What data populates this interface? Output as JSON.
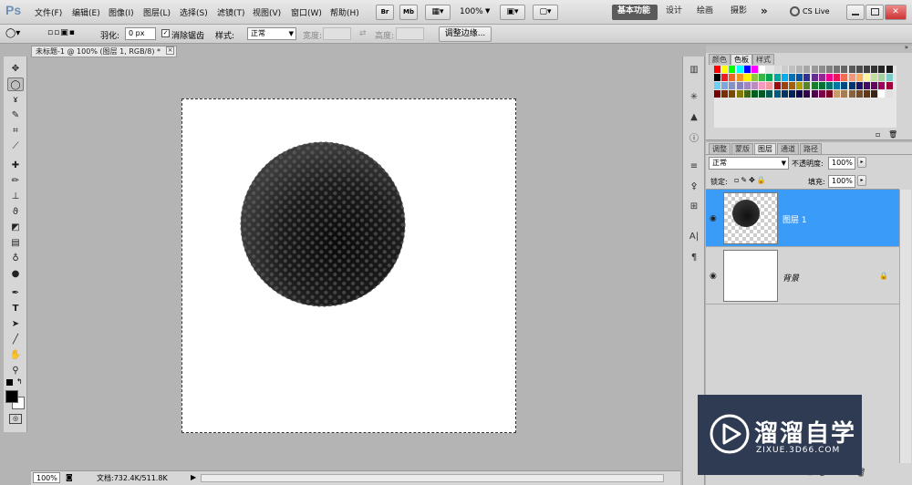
{
  "app": {
    "logo": "Ps",
    "menus": [
      "文件(F)",
      "编辑(E)",
      "图像(I)",
      "图层(L)",
      "选择(S)",
      "滤镜(T)",
      "视图(V)",
      "窗口(W)",
      "帮助(H)"
    ],
    "quick_buttons": [
      "Br",
      "Mb"
    ],
    "zoom_value": "100%",
    "workspaces": [
      "基本功能",
      "设计",
      "绘画",
      "摄影"
    ],
    "more": "»",
    "cs_live": "CS Live"
  },
  "options": {
    "feather_label": "羽化:",
    "feather_value": "0 px",
    "antialias_label": "消除锯齿",
    "style_label": "样式:",
    "style_value": "正常",
    "width_label": "宽度:",
    "height_label": "高度:",
    "refine_edge": "调整边缘..."
  },
  "document": {
    "tab_title": "未标题-1 @ 100% (图层 1, RGB/8) *",
    "close": "×"
  },
  "status": {
    "zoom": "100%",
    "doc_info": "文档:732.4K/511.8K"
  },
  "swatch_panel": {
    "tabs": [
      "颜色",
      "色板",
      "样式"
    ],
    "active_tab": "色板",
    "colors": [
      [
        "#ff0000",
        "#ffff00",
        "#00ff00",
        "#00ffff",
        "#0000ff",
        "#ff00ff",
        "#ffffff",
        "#e6e6e6",
        "#d9d9d9",
        "#cccccc",
        "#bfbfbf",
        "#b3b3b3",
        "#a6a6a6",
        "#999999",
        "#8c8c8c",
        "#808080",
        "#737373",
        "#666666",
        "#595959",
        "#4d4d4d",
        "#404040",
        "#333333",
        "#262626",
        "#1a1a1a"
      ],
      [
        "#000000",
        "#ee1d24",
        "#f16522",
        "#f7941d",
        "#fff200",
        "#8dc63f",
        "#39b54a",
        "#00a651",
        "#00a99d",
        "#00aeef",
        "#0072bc",
        "#0054a6",
        "#2e3192",
        "#662d91",
        "#92278f",
        "#ec008c",
        "#ed145b",
        "#f26c4f",
        "#f69679",
        "#fbaf5d",
        "#fff799",
        "#c4df9b",
        "#a3d39c",
        "#7accc8"
      ],
      [
        "#6dcff6",
        "#7da7d9",
        "#8393ca",
        "#8781bd",
        "#a186be",
        "#bd8cbf",
        "#f49ac1",
        "#f5989d",
        "#9e0b0f",
        "#a0410d",
        "#a3620a",
        "#aba000",
        "#598527",
        "#197b30",
        "#007236",
        "#00746b",
        "#0076a3",
        "#004a80",
        "#003471",
        "#1b1464",
        "#440e62",
        "#630460",
        "#9e005d",
        "#9e0039"
      ],
      [
        "#790000",
        "#7b2e00",
        "#7d4900",
        "#827b00",
        "#406618",
        "#005e20",
        "#005826",
        "#005952",
        "#005b7f",
        "#003663",
        "#002157",
        "#0d004c",
        "#32004b",
        "#4b0049",
        "#7b0046",
        "#7a0026",
        "#c69c6d",
        "#a67c52",
        "#8c6239",
        "#754c24",
        "#603913",
        "#3c2415",
        "#ffffff",
        "#e0e0e0"
      ]
    ]
  },
  "layers_panel": {
    "tabs": [
      "调整",
      "蒙版",
      "图层",
      "通道",
      "路径"
    ],
    "active_tab": "图层",
    "blend_mode": "正常",
    "opacity_label": "不透明度:",
    "opacity_value": "100%",
    "lock_label": "锁定:",
    "fill_label": "填充:",
    "fill_value": "100%",
    "layers": [
      {
        "name": "图层 1",
        "selected": true
      },
      {
        "name": "背景",
        "selected": false
      }
    ]
  },
  "watermark": {
    "title": "溜溜自学",
    "url": "ZIXUE.3D66.COM"
  },
  "colors": {
    "selection_blue": "#3a9cf8",
    "workspace_active": "#5a5a5a"
  }
}
